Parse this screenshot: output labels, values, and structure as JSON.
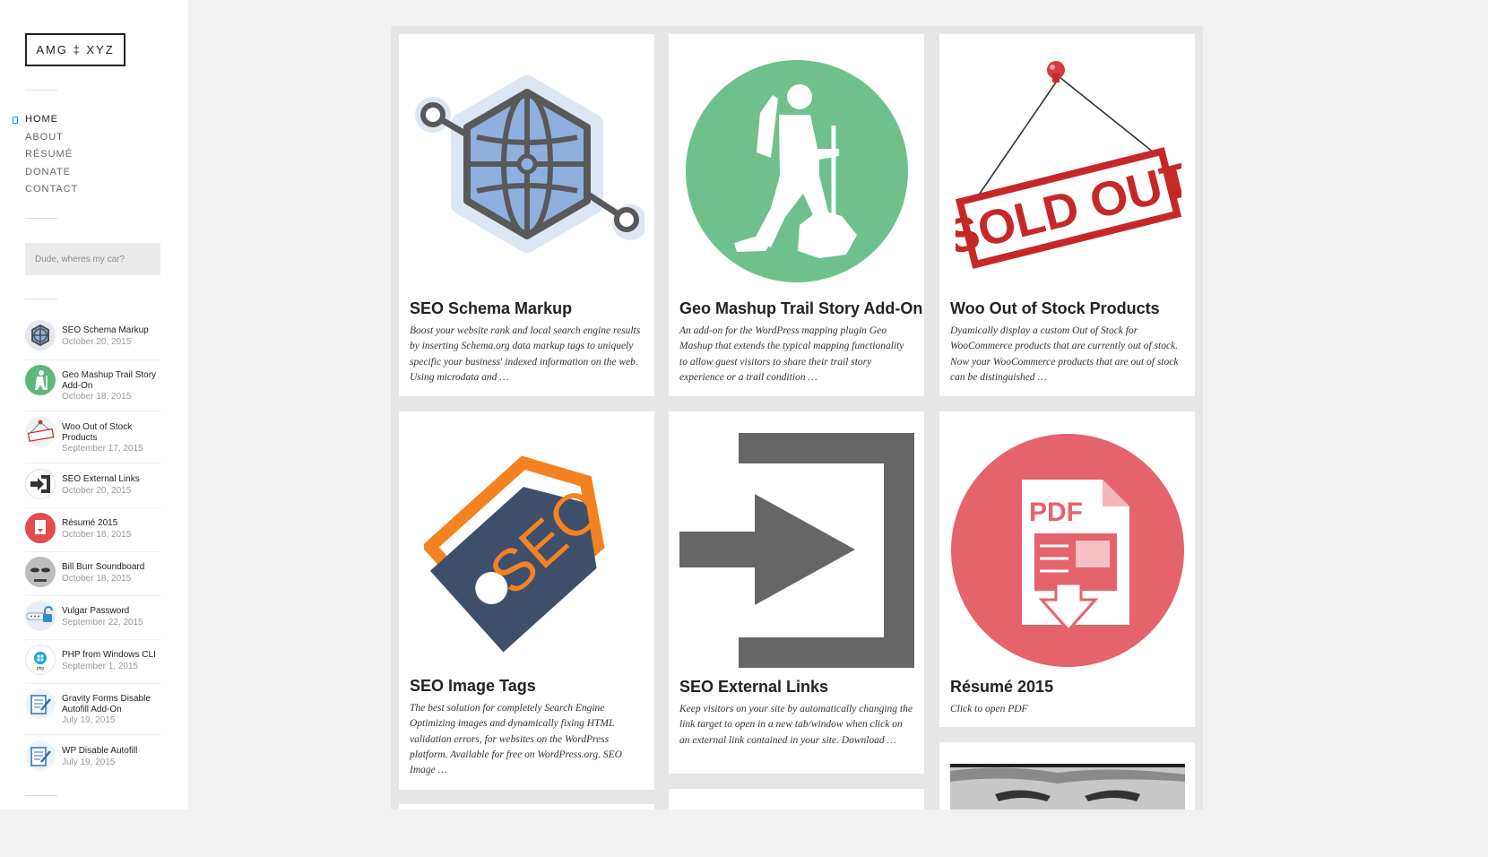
{
  "site": {
    "logo": "AMG ‡ XYZ"
  },
  "nav": {
    "items": [
      "HOME",
      "ABOUT",
      "RÉSUMÉ",
      "DONATE",
      "CONTACT"
    ],
    "active": "HOME"
  },
  "search": {
    "placeholder": "Dude, wheres my car?"
  },
  "recent_posts": [
    {
      "title": "SEO Schema Markup",
      "date": "October 20, 2015",
      "icon": "globe-icon"
    },
    {
      "title": "Geo Mashup Trail Story Add-On",
      "date": "October 18, 2015",
      "icon": "hiker-icon"
    },
    {
      "title": "Woo Out of Stock Products",
      "date": "September 17, 2015",
      "icon": "sold-out-icon"
    },
    {
      "title": "SEO External Links",
      "date": "October 20, 2015",
      "icon": "external-link-icon"
    },
    {
      "title": "Résumé 2015",
      "date": "October 18, 2015",
      "icon": "pdf-icon"
    },
    {
      "title": "Bill Burr Soundboard",
      "date": "October 18, 2015",
      "icon": "face-icon"
    },
    {
      "title": "Vulgar Password",
      "date": "September 22, 2015",
      "icon": "password-icon"
    },
    {
      "title": "PHP from Windows CLI",
      "date": "September 1, 2015",
      "icon": "windows-php-icon"
    },
    {
      "title": "Gravity Forms Disable Autofill Add-On",
      "date": "July 19, 2015",
      "icon": "form-edit-icon"
    },
    {
      "title": "WP Disable Autofill",
      "date": "July 19, 2015",
      "icon": "form-edit-icon"
    }
  ],
  "posts": [
    {
      "title": "SEO Schema Markup",
      "excerpt": "Boost your website rank and local search engine results by inserting Schema.org data markup tags to uniquely specific your business' indexed information on the web. Using microdata and …",
      "icon": "schema-globe-icon"
    },
    {
      "title": "Geo Mashup Trail Story Add-On",
      "excerpt": "An add-on for the WordPress mapping plugin Geo Mashup that extends the typical mapping functionality to allow guest visitors to share their trail story experience or a trail condition …",
      "icon": "hiker-icon"
    },
    {
      "title": "Woo Out of Stock Products",
      "excerpt": "Dyamically display a custom Out of Stock for WooCommerce products that are currently out of stock. Now your WooCommerce products that are out of stock can be distinguished …",
      "icon": "sold-out-sign-icon",
      "image_text": "SOLD OUT"
    },
    {
      "title": "SEO Image Tags",
      "excerpt": "The best solution for completely Search Engine Optimizing images and dynamically fixing HTML validation errors, for websites on the WordPress platform. Available for free on WordPress.org. SEO Image …",
      "icon": "seo-tag-icon",
      "image_text": "SEO"
    },
    {
      "title": "SEO External Links",
      "excerpt": "Keep visitors on your site by automatically changing the link target to open in a new tab/window when click on an external link contained in your site. Download …",
      "icon": "external-link-icon"
    },
    {
      "title": "Résumé 2015",
      "excerpt": "Click to open PDF",
      "icon": "pdf-download-icon",
      "image_text": "PDF"
    }
  ],
  "colors": {
    "accent_blue": "#1a8fd6",
    "hiker_green": "#6fc08a",
    "pdf_red": "#e5636a",
    "seo_navy": "#3d4f6b",
    "seo_orange": "#f58220",
    "link_gray": "#666666"
  }
}
